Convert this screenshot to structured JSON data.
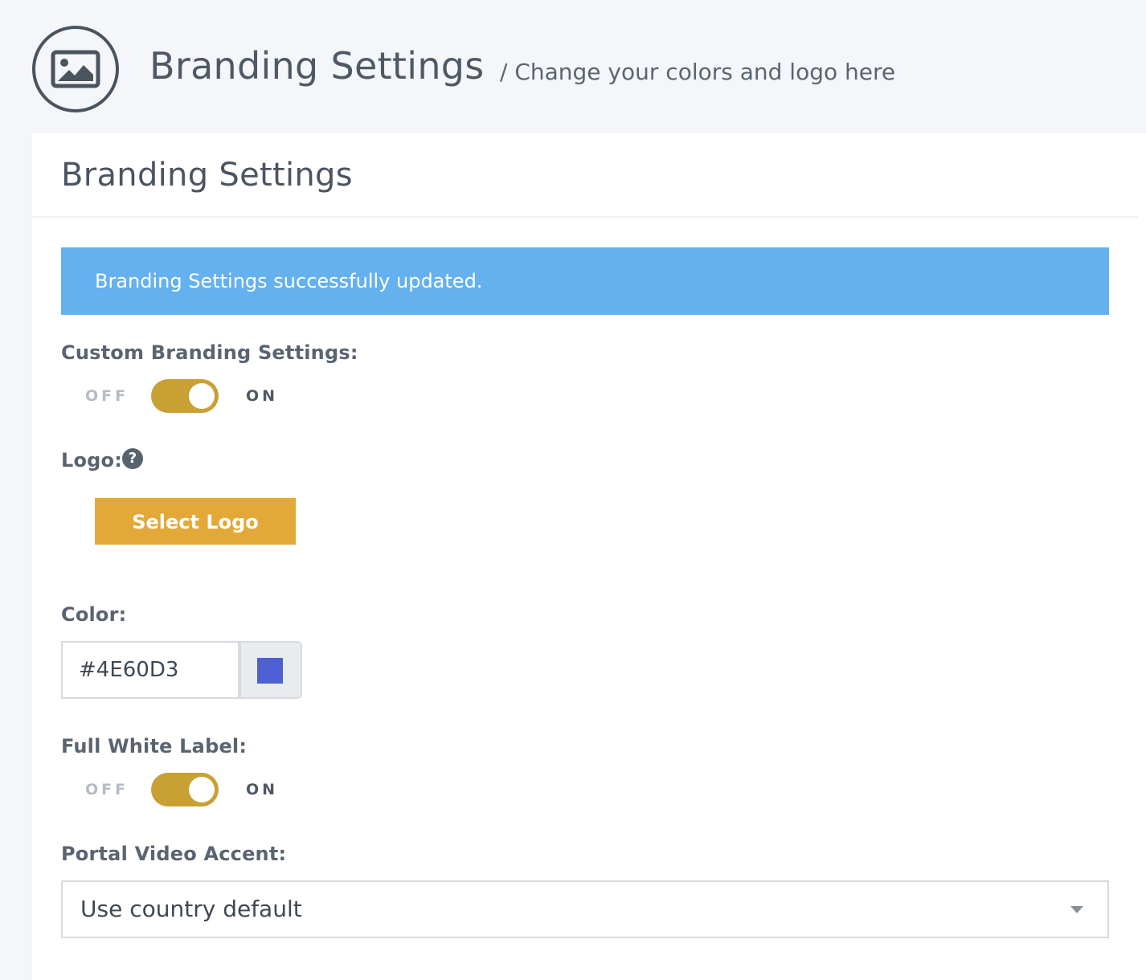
{
  "header": {
    "icon": "image-icon",
    "title": "Branding Settings",
    "subtitle": "/ Change your colors and logo here"
  },
  "card": {
    "title": "Branding Settings"
  },
  "alert": {
    "message": "Branding Settings successfully updated.",
    "color": "#65b0ee"
  },
  "custom_branding": {
    "label": "Custom Branding Settings:",
    "off_label": "OFF",
    "on_label": "ON",
    "state": "on"
  },
  "logo": {
    "label": "Logo:",
    "help_icon": "question-circle-icon",
    "help_glyph": "?",
    "button_label": "Select Logo",
    "button_color": "#e3a938"
  },
  "color": {
    "label": "Color:",
    "value": "#4E60D3",
    "swatch": "#4E60D3"
  },
  "full_white_label": {
    "label": "Full White Label:",
    "off_label": "OFF",
    "on_label": "ON",
    "state": "on"
  },
  "portal_video_accent": {
    "label": "Portal Video Accent:",
    "selected": "Use country default"
  },
  "colors": {
    "toggle_on": "#c9a034",
    "page_bg": "#f4f6f9"
  }
}
